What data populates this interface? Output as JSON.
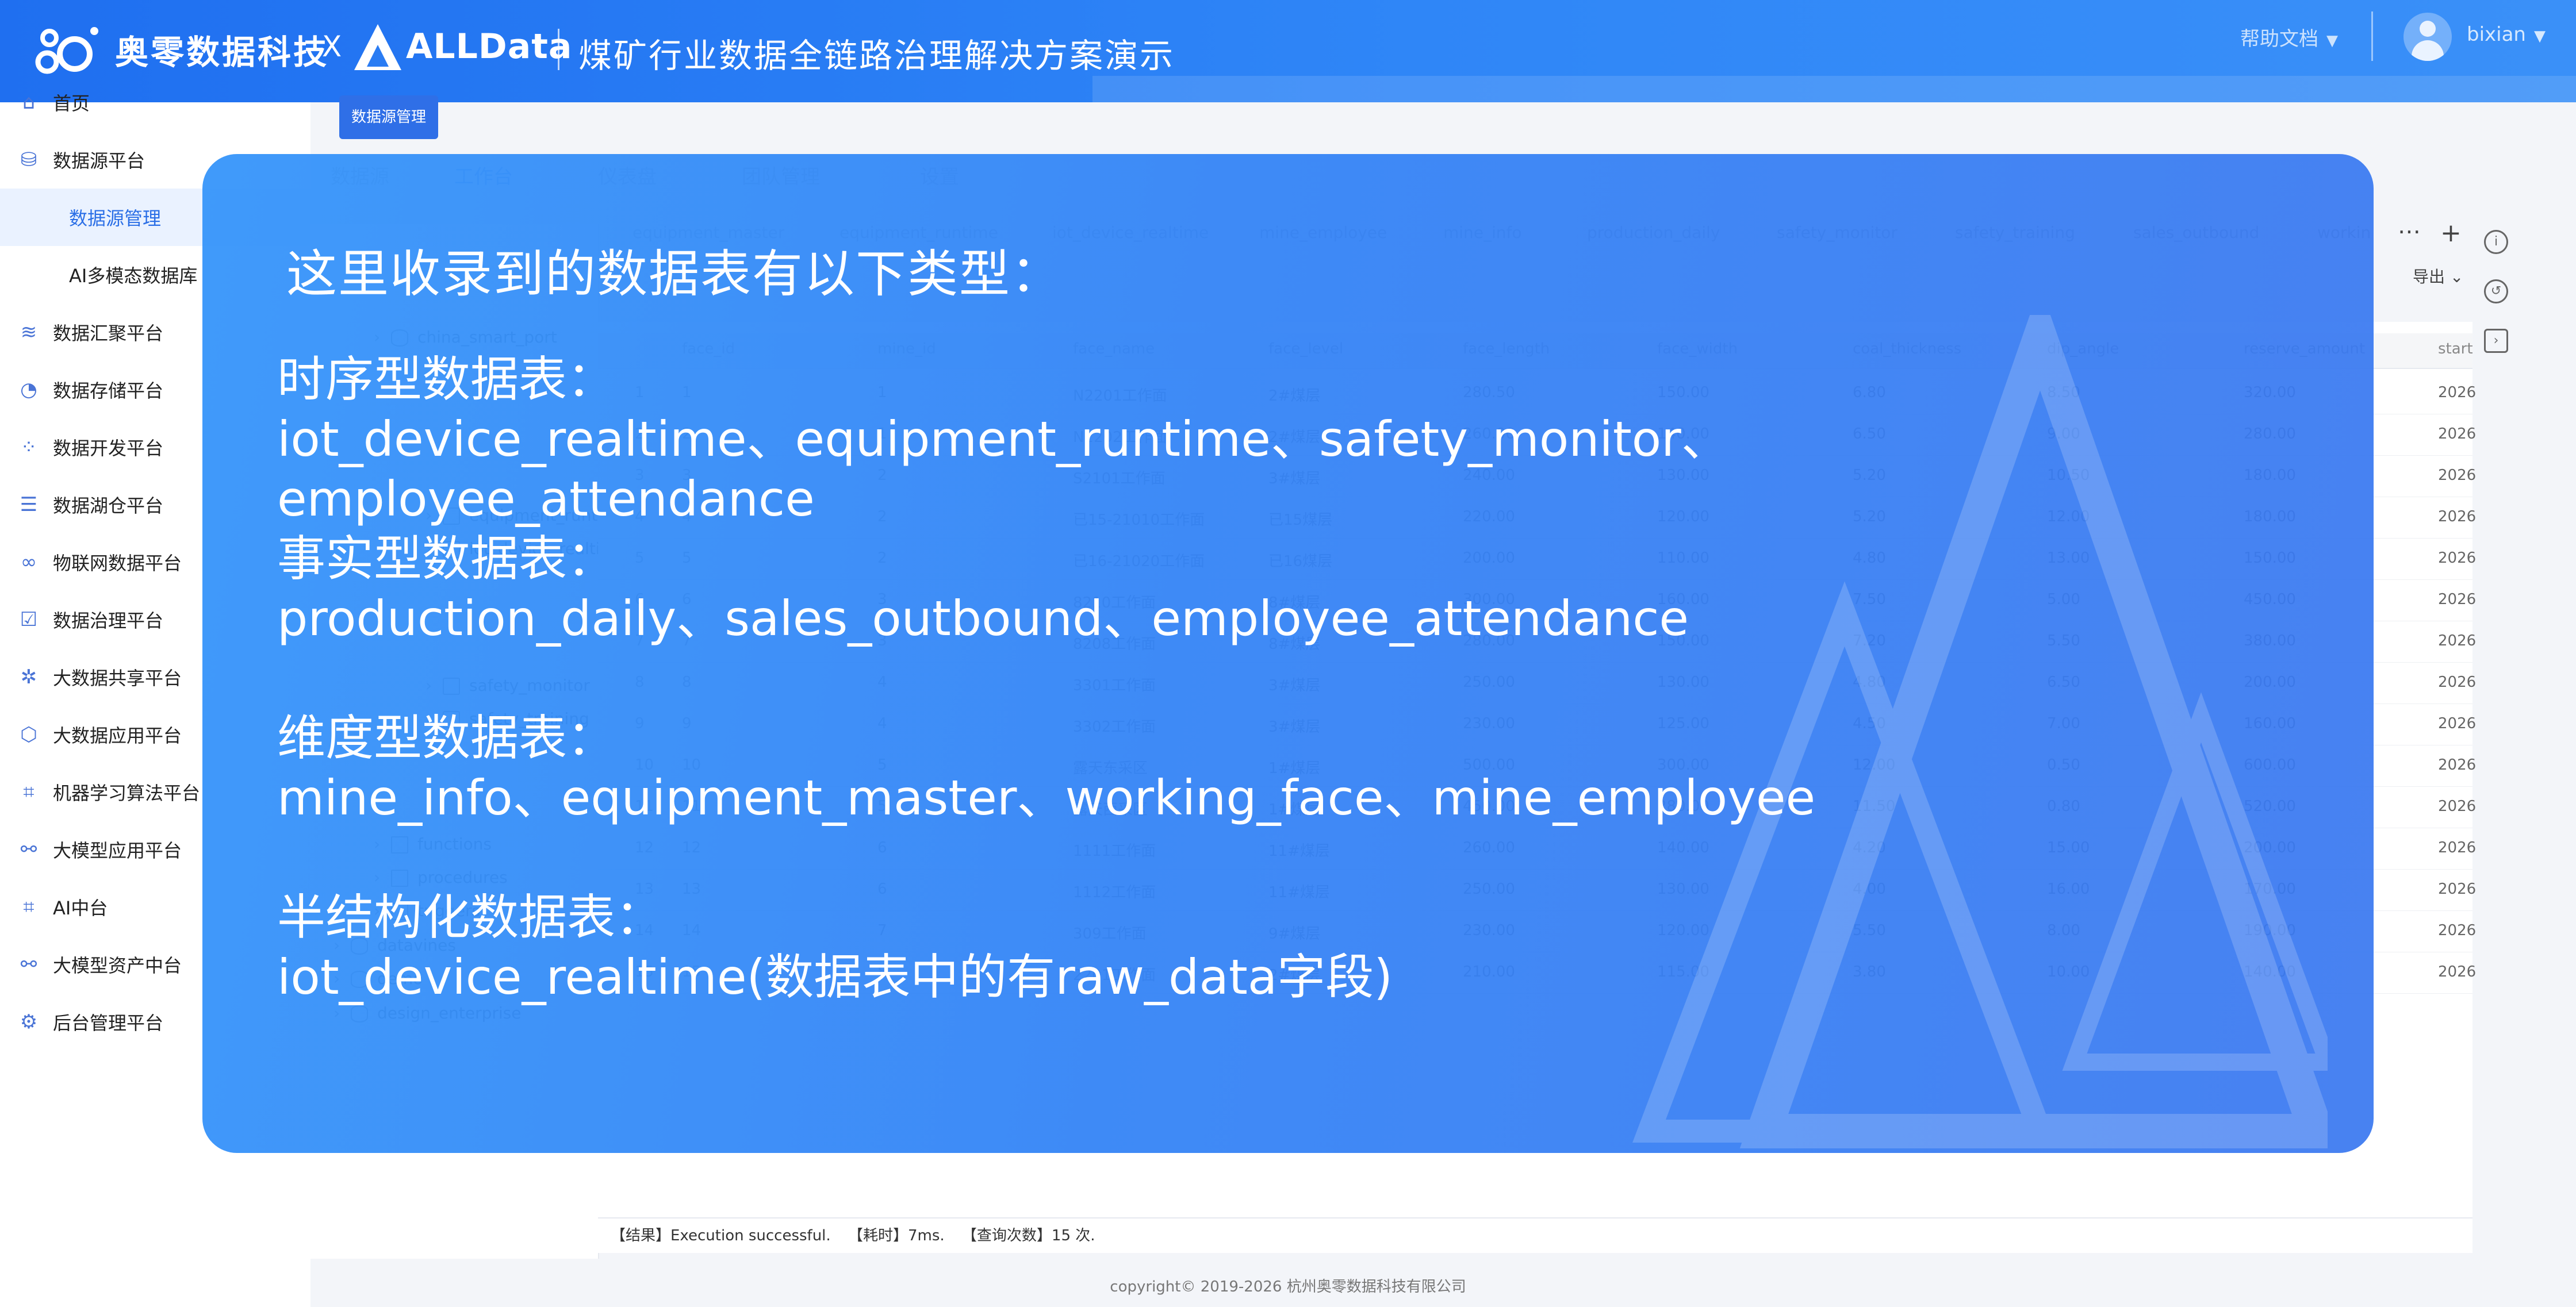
{
  "header": {
    "brand": "奥零数据科技",
    "x_mark": "X",
    "partner": "ALLData",
    "title": "煤矿行业数据全链路治理解决方案演示",
    "help": "帮助文档",
    "user": "bixian",
    "caret": "▼"
  },
  "sidebar": {
    "items": [
      {
        "label": "首页",
        "icon": "home-icon",
        "glyph": "⌂"
      },
      {
        "label": "数据源平台",
        "icon": "database-icon",
        "glyph": "⛁"
      },
      {
        "label": "数据源管理",
        "sub": true,
        "active": true
      },
      {
        "label": "AI多模态数据库",
        "sub": true
      },
      {
        "label": "数据汇聚平台",
        "icon": "layers-icon",
        "glyph": "≋"
      },
      {
        "label": "数据存储平台",
        "icon": "chart-icon",
        "glyph": "◔"
      },
      {
        "label": "数据开发平台",
        "icon": "grid-icon",
        "glyph": "⁘"
      },
      {
        "label": "数据湖仓平台",
        "icon": "stack-icon",
        "glyph": "☰"
      },
      {
        "label": "物联网数据平台",
        "icon": "link-icon",
        "glyph": "∞"
      },
      {
        "label": "数据治理平台",
        "icon": "check-icon",
        "glyph": "☑"
      },
      {
        "label": "大数据共享平台",
        "icon": "share-icon",
        "glyph": "✲"
      },
      {
        "label": "大数据应用平台",
        "icon": "cube-icon",
        "glyph": "⬡"
      },
      {
        "label": "机器学习算法平台",
        "icon": "algorithm-icon",
        "glyph": "⌗"
      },
      {
        "label": "大模型应用平台",
        "icon": "network-icon",
        "glyph": "⚯"
      },
      {
        "label": "AI中台",
        "icon": "ai-icon",
        "glyph": "⌗"
      },
      {
        "label": "大模型资产中台",
        "icon": "asset-icon",
        "glyph": "⚯"
      },
      {
        "label": "后台管理平台",
        "icon": "settings-icon",
        "glyph": "⚙"
      }
    ]
  },
  "main": {
    "crumb_tag": "数据源管理",
    "top_tabs": [
      "数据源",
      "工作台",
      "仪表盘",
      "团队管理",
      "设置"
    ],
    "table_tabs": [
      "2024年第一季度...MySQL",
      "equipment_master",
      "equipment_runtime",
      "iot_device_realtime",
      "mine_employee",
      "mine_info",
      "production_daily",
      "safety_monitor",
      "safety_training",
      "sales_outbound",
      "workin"
    ],
    "export": "导出",
    "where": "WHERE",
    "order_by": "ORDER BY",
    "columns": [
      "face_id",
      "mine_id",
      "face_name",
      "face_level",
      "face_length",
      "face_width",
      "coal_thickness",
      "dip_angle",
      "reserve_amount",
      "start"
    ],
    "rows": [
      [
        "1",
        "1",
        "1",
        "N2201工作面",
        "2#煤层",
        "280.50",
        "150.00",
        "6.80",
        "8.50",
        "320.00",
        "2026"
      ],
      [
        "2",
        "2",
        "1",
        "N2202工作面",
        "2#煤层",
        "260.00",
        "140.00",
        "6.50",
        "9.00",
        "280.00",
        "2026"
      ],
      [
        "3",
        "3",
        "2",
        "S2101工作面",
        "3#煤层",
        "240.00",
        "130.00",
        "5.20",
        "10.50",
        "180.00",
        "2026"
      ],
      [
        "4",
        "4",
        "2",
        "已15-21010工作面",
        "已15煤层",
        "220.00",
        "120.00",
        "5.20",
        "12.00",
        "180.00",
        "2026"
      ],
      [
        "5",
        "5",
        "2",
        "已16-21020工作面",
        "已16煤层",
        "200.00",
        "110.00",
        "4.80",
        "13.00",
        "150.00",
        "2026"
      ],
      [
        "6",
        "6",
        "3",
        "8210工作面",
        "8#煤层",
        "300.00",
        "160.00",
        "7.50",
        "5.00",
        "450.00",
        "2026"
      ],
      [
        "7",
        "7",
        "3",
        "8208工作面",
        "8#煤层",
        "280.00",
        "150.00",
        "7.20",
        "5.50",
        "380.00",
        "2026"
      ],
      [
        "8",
        "8",
        "4",
        "3301工作面",
        "3#煤层",
        "250.00",
        "130.00",
        "4.80",
        "6.50",
        "200.00",
        "2026"
      ],
      [
        "9",
        "9",
        "4",
        "3302工作面",
        "3#煤层",
        "230.00",
        "125.00",
        "4.50",
        "7.00",
        "160.00",
        "2026"
      ],
      [
        "10",
        "10",
        "5",
        "露天东采区",
        "1#煤层",
        "500.00",
        "300.00",
        "12.00",
        "0.50",
        "600.00",
        "2026"
      ],
      [
        "11",
        "11",
        "5",
        "露天西采区",
        "1#煤层",
        "450.00",
        "280.00",
        "11.50",
        "0.80",
        "520.00",
        "2026"
      ],
      [
        "12",
        "12",
        "6",
        "1111工作面",
        "11#煤层",
        "260.00",
        "140.00",
        "4.20",
        "15.00",
        "200.00",
        "2026"
      ],
      [
        "13",
        "13",
        "6",
        "1112工作面",
        "11#煤层",
        "250.00",
        "130.00",
        "4.00",
        "16.00",
        "170.00",
        "2026"
      ],
      [
        "14",
        "14",
        "7",
        "309工作面",
        "9#煤层",
        "230.00",
        "120.00",
        "5.50",
        "8.00",
        "190.00",
        "2026"
      ],
      [
        "15",
        "15",
        "8",
        "2201工作面",
        "2#煤层",
        "210.00",
        "115.00",
        "3.80",
        "10.00",
        "140.00",
        "2026"
      ]
    ],
    "tree": [
      {
        "label": "china_smart_port",
        "kind": "db"
      },
      {
        "label": "equipment_runtime",
        "kind": "table"
      },
      {
        "label": "iot_device_realtime",
        "kind": "table"
      },
      {
        "label": "safety_monitor",
        "kind": "table"
      },
      {
        "label": "safety_training",
        "kind": "table"
      },
      {
        "label": "functions",
        "kind": "folder"
      },
      {
        "label": "procedures",
        "kind": "folder"
      },
      {
        "label": "triggers",
        "kind": "folder"
      },
      {
        "label": "datavines",
        "kind": "db"
      },
      {
        "label": "demo",
        "kind": "db"
      },
      {
        "label": "design_enterprise",
        "kind": "db"
      }
    ],
    "status": {
      "result": "【结果】Execution successful.",
      "time": "【耗时】7ms.",
      "count": "【查询次数】15 次."
    }
  },
  "footer": "copyright© 2019-2026 杭州奥零数据科技有限公司",
  "overlay": {
    "heading": "这里收录到的数据表有以下类型：",
    "sections": [
      {
        "label": "时序型数据表：",
        "lines": [
          "iot_device_realtime、equipment_runtime、safety_monitor、",
          "employee_attendance"
        ]
      },
      {
        "label": "事实型数据表：",
        "lines": [
          "production_daily、sales_outbound、employee_attendance"
        ]
      },
      {
        "label": "维度型数据表：",
        "lines": [
          "mine_info、equipment_master、working_face、mine_employee"
        ]
      },
      {
        "label": "半结构化数据表：",
        "lines": [
          "iot_device_realtime(数据表中的有raw_data字段)"
        ]
      }
    ]
  },
  "colors": {
    "header_blue": "#2f86f7",
    "overlay_blue": "#3896fa",
    "accent": "#2f6fe7"
  }
}
